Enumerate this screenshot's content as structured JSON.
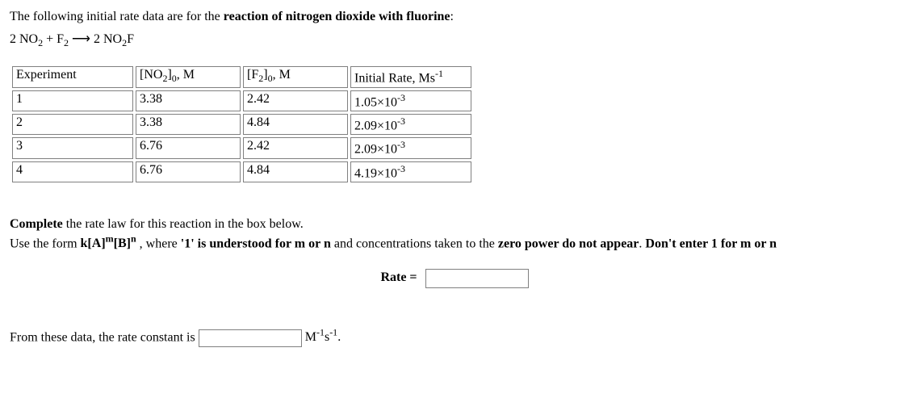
{
  "intro": {
    "text_before": "The following initial rate data are for the ",
    "bold": "reaction of nitrogen dioxide with fluorine",
    "text_after": ":"
  },
  "equation": {
    "lhs1_coef": "2 ",
    "lhs1_species": "NO",
    "lhs1_sub": "2",
    "plus": " + ",
    "lhs2_species": "F",
    "lhs2_sub": "2",
    "arrow": " ⟶ ",
    "rhs_coef": "2 ",
    "rhs_species": "NO",
    "rhs_sub": "2",
    "rhs_suffix": "F"
  },
  "table": {
    "headers": {
      "c1": "Experiment",
      "c2_open": "[NO",
      "c2_sub": "2",
      "c2_close": "]",
      "c2_subo": "0",
      "c2_unit": ", M",
      "c3_open": "[F",
      "c3_sub": "2",
      "c3_close": "]",
      "c3_subo": "0",
      "c3_unit": ", M",
      "c4_pre": "Initial Rate, Ms",
      "c4_sup": "-1"
    },
    "rows": [
      {
        "exp": "1",
        "no2": "3.38",
        "f2": "2.42",
        "rate_m": "1.05×10",
        "rate_e": "-3"
      },
      {
        "exp": "2",
        "no2": "3.38",
        "f2": "4.84",
        "rate_m": "2.09×10",
        "rate_e": "-3"
      },
      {
        "exp": "3",
        "no2": "6.76",
        "f2": "2.42",
        "rate_m": "2.09×10",
        "rate_e": "-3"
      },
      {
        "exp": "4",
        "no2": "6.76",
        "f2": "4.84",
        "rate_m": "4.19×10",
        "rate_e": "-3"
      }
    ]
  },
  "instr": {
    "line1_bold": "Complete",
    "line1_rest": " the rate law for this reaction in the box below.",
    "line2_pre": "Use the form ",
    "line2_form_k": "k[A]",
    "line2_form_m": "m",
    "line2_form_b": "[B]",
    "line2_form_n": "n",
    "line2_mid": " , where ",
    "line2_one": "'1' is understood for m or n",
    "line2_mid2": " and concentrations taken to the ",
    "line2_zero": "zero power do not appear",
    "line2_mid3": ". ",
    "line2_dont": "Don't enter 1 for m or n"
  },
  "rate": {
    "label": "Rate ="
  },
  "k": {
    "pre": "From these data, the rate constant is ",
    "unit_pre": "M",
    "unit_sup1": "-1",
    "unit_mid": "s",
    "unit_sup2": "-1",
    "unit_end": "."
  },
  "chart_data": {
    "type": "table",
    "columns": [
      "Experiment",
      "[NO2]0, M",
      "[F2]0, M",
      "Initial Rate, Ms^-1"
    ],
    "rows": [
      [
        1,
        3.38,
        2.42,
        0.00105
      ],
      [
        2,
        3.38,
        4.84,
        0.00209
      ],
      [
        3,
        6.76,
        2.42,
        0.00209
      ],
      [
        4,
        6.76,
        4.84,
        0.00419
      ]
    ]
  }
}
